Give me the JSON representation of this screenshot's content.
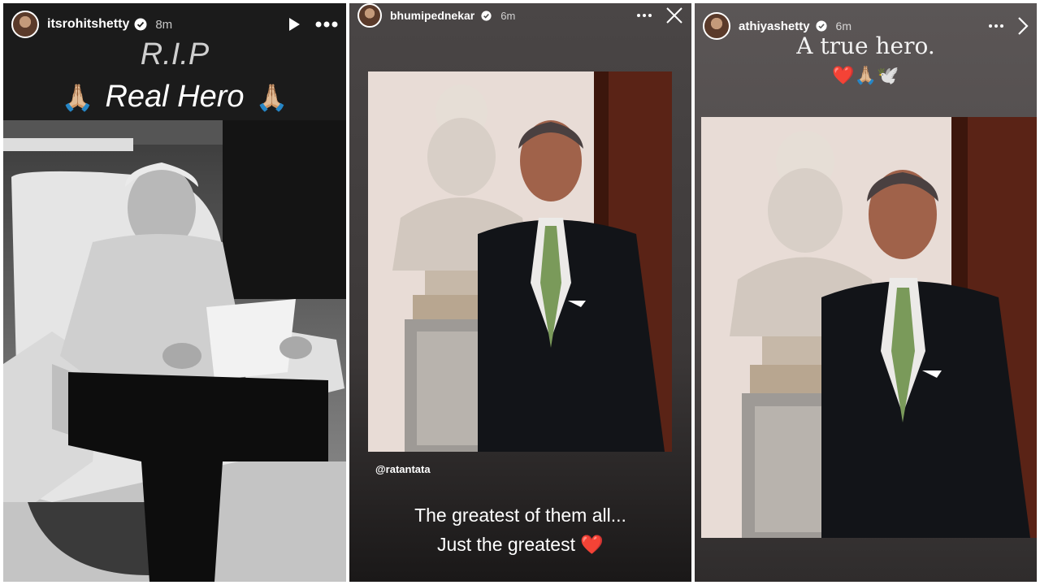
{
  "stories": [
    {
      "username": "itsrohitshetty",
      "time": "8m",
      "caption_line1": "R.I.P",
      "caption_line2": "Real Hero",
      "emoji": "🙏🏼"
    },
    {
      "username": "bhumipednekar",
      "time": "6m",
      "mention": "@ratantata",
      "quote_line1": "The greatest of them all...",
      "quote_line2": "Just the greatest",
      "heart": "❤️"
    },
    {
      "username": "athiyashetty",
      "time": "6m",
      "caption": "A true hero.",
      "emojis": "❤️🙏🏼🕊️"
    }
  ],
  "icons": [
    "verified-badge-icon",
    "play-icon",
    "more-options-icon",
    "close-icon"
  ],
  "colors": {
    "verified": "#3897f0",
    "text": "#ffffff",
    "heart": "#e0245e"
  }
}
